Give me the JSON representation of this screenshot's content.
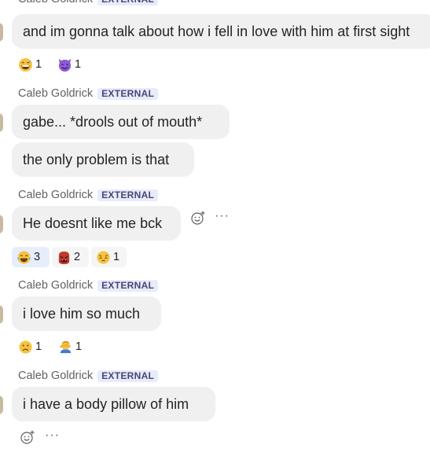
{
  "sender_name": "Caleb Goldrick",
  "external_label": "EXTERNAL",
  "messages": [
    {
      "text": "and im gonna talk about how i fell in love with him at first sight"
    },
    {
      "text": "gabe... *drools out of mouth*"
    },
    {
      "text": "the only problem is that"
    },
    {
      "text": "He doesnt like me bck"
    },
    {
      "text": "i love him so much"
    },
    {
      "text": "i have a body pillow of him"
    }
  ],
  "reactions": {
    "msg1": [
      {
        "icon": "grinning-sweat-emoji",
        "count": "1"
      },
      {
        "icon": "smiling-devil-emoji",
        "count": "1"
      }
    ],
    "msg4": [
      {
        "icon": "laughing-tears-emoji",
        "count": "3"
      },
      {
        "icon": "ogre-emoji",
        "count": "2"
      },
      {
        "icon": "pensive-emoji",
        "count": "1"
      }
    ],
    "msg5": [
      {
        "icon": "frowning-emoji",
        "count": "1"
      },
      {
        "icon": "facepalm-emoji",
        "count": "1"
      }
    ]
  },
  "icons": {
    "add_reaction": "add-reaction-icon",
    "more_options": "more-options-icon"
  },
  "colors": {
    "bubble": "#f0f0f0",
    "badge_bg": "#e8ebfa",
    "badge_text": "#464775",
    "sender_text": "#616161",
    "selected_reaction": "#e6eefb"
  }
}
